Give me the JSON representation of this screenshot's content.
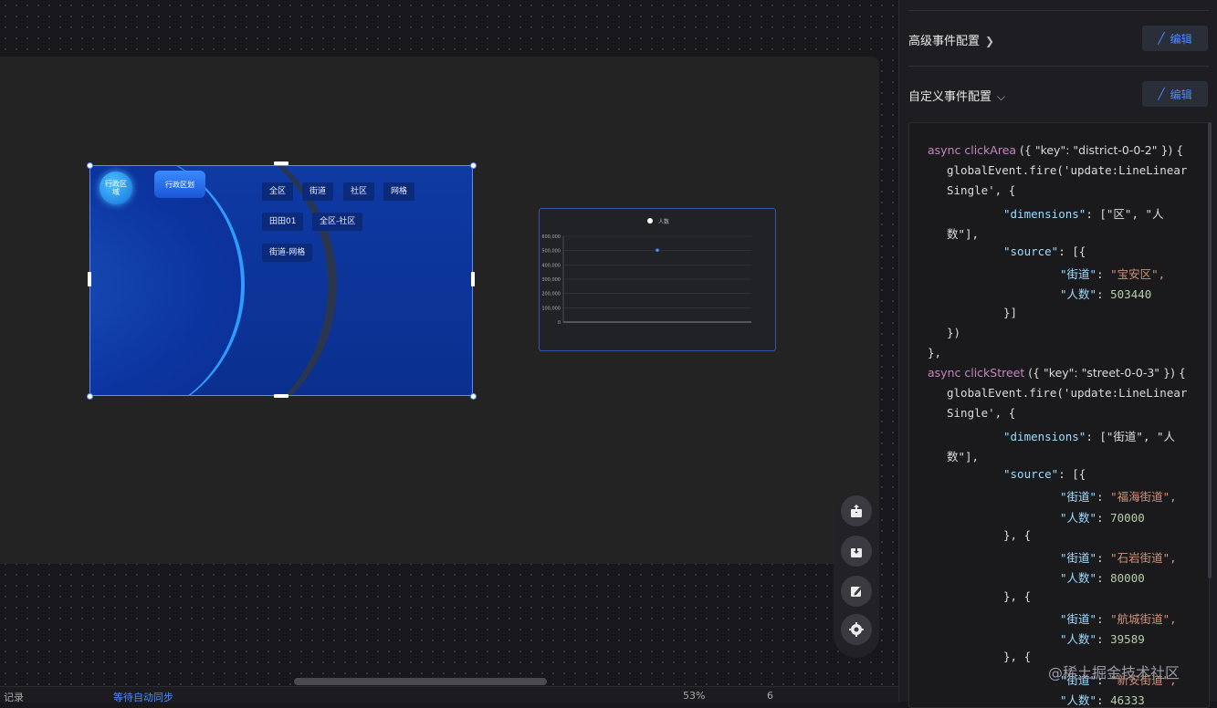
{
  "nav": {
    "bubble": "行政区\n域",
    "tab": "行政区划",
    "buttons": [
      "全区",
      "街道",
      "社区",
      "网格",
      "田田01",
      "全区-社区",
      "街道-网格"
    ]
  },
  "chart_data": {
    "type": "scatter",
    "legend": [
      "人数"
    ],
    "y_ticks": [
      "0",
      "100,000",
      "200,000",
      "300,000",
      "400,000",
      "500,000",
      "600,000"
    ],
    "series": [
      {
        "name": "人数",
        "values": [
          503440
        ]
      }
    ],
    "ylim": [
      0,
      600000
    ]
  },
  "panel": {
    "advanced_title": "高级事件配置",
    "custom_title": "自定义事件配置",
    "edit_label": "编辑"
  },
  "code": {
    "fn1": "clickArea",
    "key1": "\"district-0-0-2\"",
    "fn2": "clickStreet",
    "key2": "\"street-0-0-3\"",
    "event_line_a": "globalEvent.fire('update:LineLinear",
    "event_line_b": "Single', {",
    "dimensions_key": "\"dimensions\"",
    "dim1_a": "[\"区\", \"人",
    "dim1_b": "数\"],",
    "dim2_a": "[\"街道\", \"人",
    "dim2_b": "数\"],",
    "source_key": "\"source\"",
    "street_key": "\"街道\"",
    "people_key": "\"人数\"",
    "area_val": "\"宝安区\",",
    "area_num": "503440",
    "s1": "\"福海街道\",",
    "n1": "70000",
    "s2": "\"石岩街道\",",
    "n2": "80000",
    "s3": "\"航城街道\",",
    "n3": "39589",
    "s4": "\"新安街道\",",
    "n4": "46333"
  },
  "bottom": {
    "left": "记录",
    "mid": "等待自动同步",
    "zoom": "53%",
    "lock": "6"
  },
  "watermark": "@稀土掘金技术社区"
}
